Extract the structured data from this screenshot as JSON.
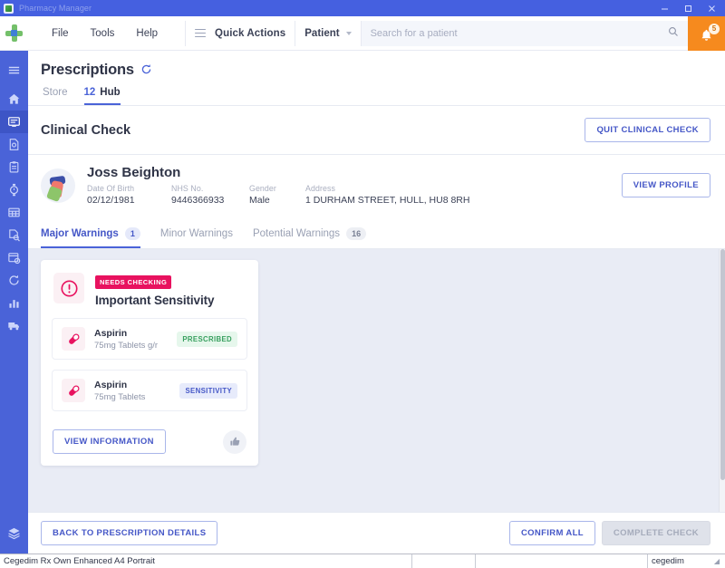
{
  "window": {
    "title": "Pharmacy Manager",
    "controls": {
      "minimize": "minimize-icon",
      "maximize": "maximize-icon",
      "close": "close-icon"
    }
  },
  "appbar": {
    "logo": "pharmacy-cross-logo",
    "menu": [
      {
        "label": "File"
      },
      {
        "label": "Tools"
      },
      {
        "label": "Help"
      }
    ],
    "quick_actions_label": "Quick Actions",
    "patient_selector_label": "Patient",
    "search": {
      "placeholder": "Search for a patient",
      "value": ""
    },
    "notifications": {
      "count": "5",
      "icon": "bell-icon"
    }
  },
  "sidebar": {
    "items": [
      {
        "name": "menu",
        "icon": "hamburger-icon"
      },
      {
        "name": "home",
        "icon": "home-icon"
      },
      {
        "name": "prescriptions",
        "icon": "monitor-icon",
        "active": true
      },
      {
        "name": "documents",
        "icon": "document-icon"
      },
      {
        "name": "clipboard",
        "icon": "clipboard-icon"
      },
      {
        "name": "stock",
        "icon": "watch-icon"
      },
      {
        "name": "grid",
        "icon": "grid-icon"
      },
      {
        "name": "reports-search",
        "icon": "file-search-icon"
      },
      {
        "name": "calendar",
        "icon": "calendar-clock-icon"
      },
      {
        "name": "refresh-history",
        "icon": "history-icon"
      },
      {
        "name": "analytics",
        "icon": "bar-chart-icon"
      },
      {
        "name": "deliveries",
        "icon": "truck-icon"
      }
    ],
    "bottom_item": {
      "name": "layers",
      "icon": "layers-icon"
    }
  },
  "page": {
    "title": "Prescriptions",
    "refresh_icon": "refresh-icon",
    "tabs": [
      {
        "label": "Store",
        "count": "",
        "active": false
      },
      {
        "label": "Hub",
        "count": "12",
        "active": true
      }
    ]
  },
  "clinical_check": {
    "title": "Clinical Check",
    "quit_button": "QUIT CLINICAL CHECK"
  },
  "patient": {
    "name": "Joss Beighton",
    "view_profile_button": "VIEW PROFILE",
    "fields": [
      {
        "label": "Date Of Birth",
        "value": "02/12/1981"
      },
      {
        "label": "NHS No.",
        "value": "9446366933"
      },
      {
        "label": "Gender",
        "value": "Male"
      },
      {
        "label": "Address",
        "value": "1 DURHAM STREET, HULL, HU8 8RH"
      }
    ]
  },
  "warning_tabs": [
    {
      "label": "Major Warnings",
      "count": "1",
      "active": true
    },
    {
      "label": "Minor Warnings",
      "count": "",
      "active": false
    },
    {
      "label": "Potential Warnings",
      "count": "16",
      "active": false
    }
  ],
  "warning_card": {
    "status_badge": "NEEDS CHECKING",
    "title": "Important Sensitivity",
    "alert_icon": "exclamation-circle-icon",
    "medications": [
      {
        "name": "Aspirin",
        "description": "75mg Tablets g/r",
        "tag": "PRESCRIBED",
        "tag_color": "#38a05f",
        "icon": "pill-icon"
      },
      {
        "name": "Aspirin",
        "description": "75mg Tablets",
        "tag": "SENSITIVITY",
        "tag_color": "#4557c7",
        "icon": "pill-icon"
      }
    ],
    "view_information_button": "VIEW INFORMATION",
    "acknowledge_icon": "thumbs-up-icon"
  },
  "actionbar": {
    "back_button": "BACK TO PRESCRIPTION DETAILS",
    "confirm_all_button": "CONFIRM ALL",
    "complete_check_button": "COMPLETE CHECK"
  },
  "statusbar": {
    "printer": "Cegedim Rx Own Enhanced A4 Portrait",
    "cell2": "",
    "cell3": "",
    "company": "cegedim"
  },
  "colors": {
    "accent": "#4a63d8",
    "titlebar": "#4560e0",
    "notification": "#f68a1e",
    "badge_pink": "#e8125f",
    "content_bg": "#e9ecf5"
  }
}
